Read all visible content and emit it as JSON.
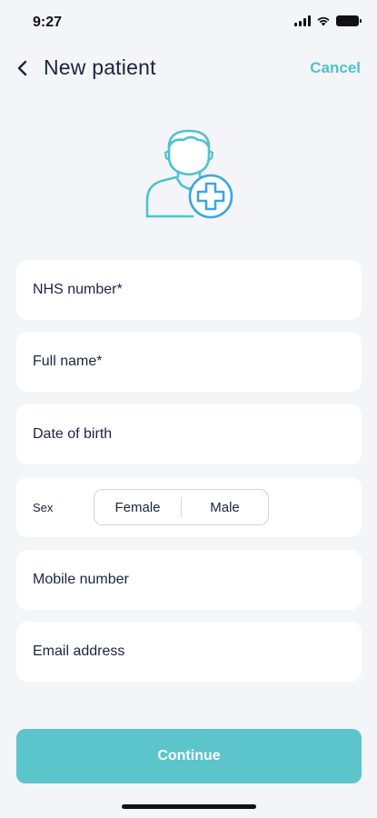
{
  "status_bar": {
    "time": "9:27",
    "icons": [
      "cellular-signal-icon",
      "wifi-icon",
      "battery-icon"
    ]
  },
  "header": {
    "back_icon": "chevron-left-icon",
    "title": "New patient",
    "cancel_label": "Cancel"
  },
  "illustration": {
    "icon": "add-user-icon"
  },
  "form": {
    "nhs_number_placeholder": "NHS number*",
    "full_name_placeholder": "Full name*",
    "date_of_birth_placeholder": "Date of birth",
    "sex": {
      "label": "Sex",
      "options": [
        "Female",
        "Male"
      ]
    },
    "mobile_number_placeholder": "Mobile number",
    "email_address_placeholder": "Email address"
  },
  "continue_label": "Continue",
  "colors": {
    "accent": "#4fc2cc",
    "button": "#5cc4cb",
    "background": "#f3f5f8",
    "card": "#ffffff",
    "text": "#1c2541",
    "illustration_line": "#4fc2cc",
    "illustration_badge": "#3aa6e0"
  }
}
